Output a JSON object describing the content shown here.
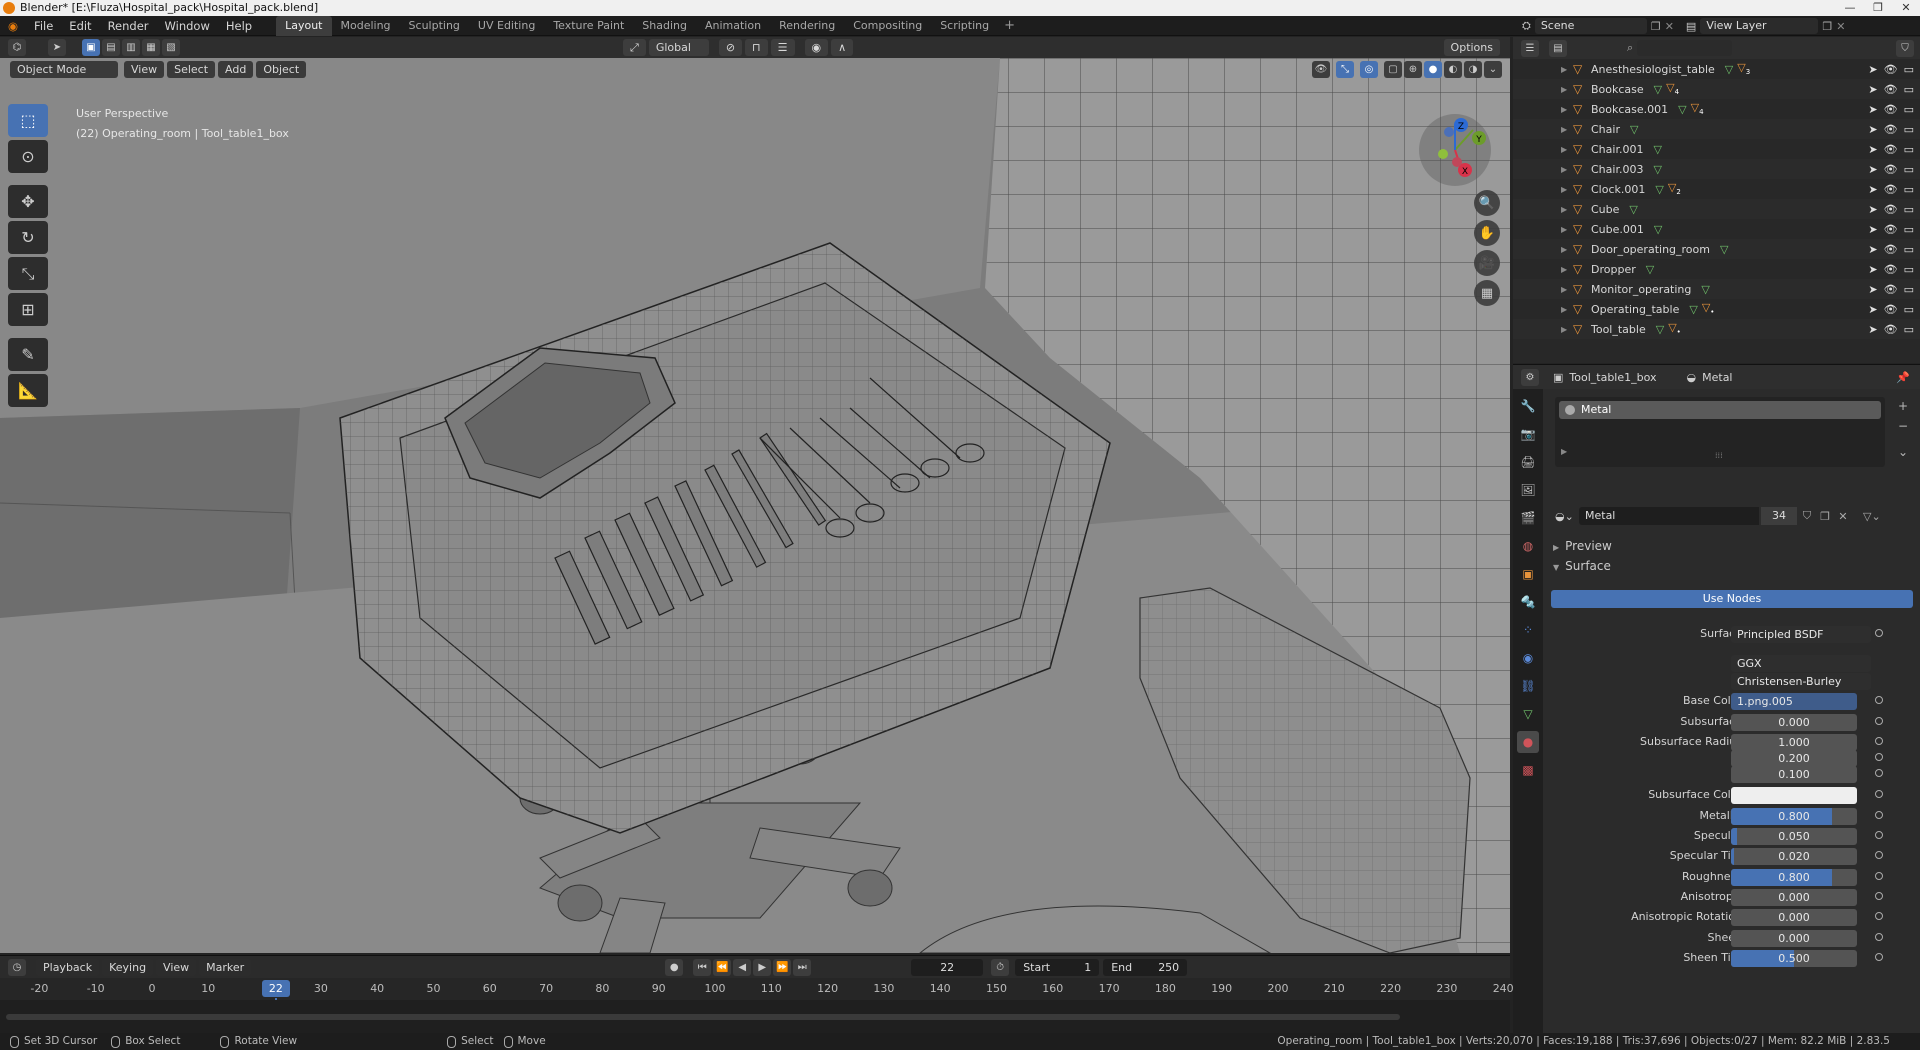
{
  "window": {
    "title": "Blender* [E:\\Fluza\\Hospital_pack\\Hospital_pack.blend]",
    "controls": [
      "—",
      "❐",
      "✕"
    ]
  },
  "menu": [
    "File",
    "Edit",
    "Render",
    "Window",
    "Help"
  ],
  "workspaces": [
    {
      "label": "Layout",
      "active": true
    },
    {
      "label": "Modeling"
    },
    {
      "label": "Sculpting"
    },
    {
      "label": "UV Editing"
    },
    {
      "label": "Texture Paint"
    },
    {
      "label": "Shading"
    },
    {
      "label": "Animation"
    },
    {
      "label": "Rendering"
    },
    {
      "label": "Compositing"
    },
    {
      "label": "Scripting"
    }
  ],
  "scene": "Scene",
  "view_layer": "View Layer",
  "viewport": {
    "orientation": "Global",
    "options_label": "Options",
    "mode": "Object Mode",
    "menus": [
      "View",
      "Select",
      "Add",
      "Object"
    ],
    "info_line1": "User Perspective",
    "info_line2": "(22) Operating_room | Tool_table1_box",
    "gizmo": {
      "z": "Z",
      "y": "Y",
      "x": "X"
    }
  },
  "tools": [
    "select-box",
    "cursor",
    "move",
    "rotate",
    "scale",
    "transform",
    "annotate",
    "measure"
  ],
  "timeline": {
    "menus": [
      "Playback",
      "Keying",
      "View",
      "Marker"
    ],
    "current_frame": "22",
    "start_label": "Start",
    "start": "1",
    "end_label": "End",
    "end": "250",
    "ticks": [
      "-20",
      "-10",
      "0",
      "10",
      "22",
      "30",
      "40",
      "50",
      "60",
      "70",
      "80",
      "90",
      "100",
      "110",
      "120",
      "130",
      "140",
      "150",
      "160",
      "170",
      "180",
      "190",
      "200",
      "210",
      "220",
      "230",
      "240"
    ]
  },
  "statusbar": {
    "items": [
      "Set 3D Cursor",
      "Box Select",
      "Rotate View",
      "Select",
      "Move"
    ],
    "info": "Operating_room | Tool_table1_box | Verts:20,070 | Faces:19,188 | Tris:37,696 | Objects:0/27 | Mem: 82.2 MiB | 2.83.5"
  },
  "outliner": {
    "search_placeholder": "",
    "items": [
      {
        "name": "Anesthesiologist_table",
        "mat": "3"
      },
      {
        "name": "Bookcase",
        "mat": "4"
      },
      {
        "name": "Bookcase.001",
        "mat": "4"
      },
      {
        "name": "Chair",
        "mat": ""
      },
      {
        "name": "Chair.001",
        "mat": ""
      },
      {
        "name": "Chair.003",
        "mat": ""
      },
      {
        "name": "Clock.001",
        "mat": "2"
      },
      {
        "name": "Cube",
        "mat": ""
      },
      {
        "name": "Cube.001",
        "mat": ""
      },
      {
        "name": "Door_operating_room",
        "mat": ""
      },
      {
        "name": "Dropper",
        "mat": ""
      },
      {
        "name": "Monitor_operating",
        "mat": ""
      },
      {
        "name": "Operating_table",
        "mat": "•"
      },
      {
        "name": "Tool_table",
        "mat": "•"
      }
    ]
  },
  "properties": {
    "object_name": "Tool_table1_box",
    "material_name": "Metal",
    "slot": "Metal",
    "material_field": "Metal",
    "users": "34",
    "preview_label": "Preview",
    "surface_label": "Surface",
    "use_nodes_label": "Use Nodes",
    "rows": [
      {
        "label": "Surface",
        "value": "Principled BSDF",
        "kind": "dark"
      },
      {
        "label": "",
        "value": "GGX",
        "kind": "dark"
      },
      {
        "label": "",
        "value": "Christensen-Burley",
        "kind": "dark"
      },
      {
        "label": "Base Color",
        "value": "1.png.005",
        "kind": "blue"
      },
      {
        "label": "Subsurface",
        "value": "0.000",
        "fill": 0
      },
      {
        "label": "Subsurface Radius",
        "value": "1.000",
        "fill": 0
      },
      {
        "label": "",
        "value": "0.200",
        "fill": 0
      },
      {
        "label": "",
        "value": "0.100",
        "fill": 0
      },
      {
        "label": "Subsurface Color",
        "value": "",
        "kind": "white"
      },
      {
        "label": "Metallic",
        "value": "0.800",
        "fill": 0.8
      },
      {
        "label": "Specular",
        "value": "0.050",
        "fill": 0.05
      },
      {
        "label": "Specular Tint",
        "value": "0.020",
        "fill": 0.02
      },
      {
        "label": "Roughness",
        "value": "0.800",
        "fill": 0.8
      },
      {
        "label": "Anisotropic",
        "value": "0.000",
        "fill": 0
      },
      {
        "label": "Anisotropic Rotation",
        "value": "0.000",
        "fill": 0
      },
      {
        "label": "Sheen",
        "value": "0.000",
        "fill": 0
      },
      {
        "label": "Sheen Tint",
        "value": "0.500",
        "fill": 0.5
      }
    ]
  }
}
